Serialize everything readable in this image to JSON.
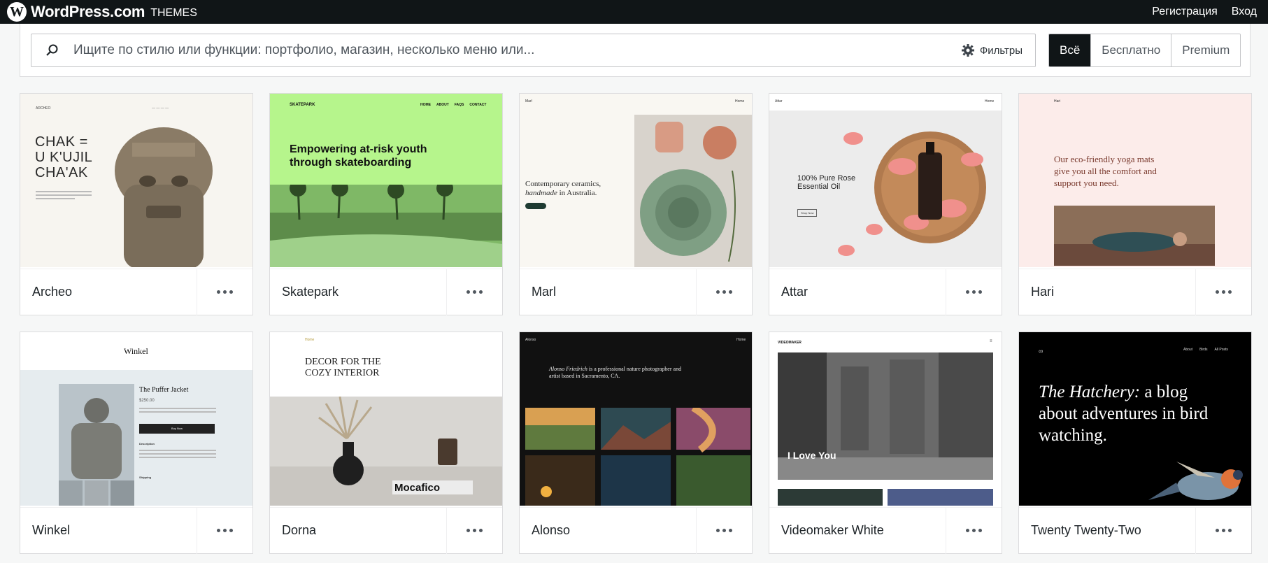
{
  "header": {
    "brand": "WordPress.com",
    "section": "THEMES",
    "signup": "Регистрация",
    "login": "Вход"
  },
  "search": {
    "placeholder": "Ищите по стилю или функции: портфолио, магазин, несколько меню или...",
    "filters_label": "Фильтры"
  },
  "price_filter": {
    "options": [
      "Всё",
      "Бесплатно",
      "Premium"
    ],
    "selected": "Всё"
  },
  "themes": [
    {
      "name": "Archeo",
      "preview": {
        "title_lines": [
          "CHAK =",
          "U K'UJIL",
          "CHA'AK"
        ],
        "logo": "ARCHEO"
      }
    },
    {
      "name": "Skatepark",
      "preview": {
        "headline": "Empowering at-risk youth through skateboarding",
        "logo": "SKATEPARK",
        "nav": [
          "HOME",
          "ABOUT",
          "FAQS",
          "CONTACT"
        ]
      }
    },
    {
      "name": "Marl",
      "preview": {
        "headline_a": "Contemporary ceramics,",
        "headline_b": "handmade",
        "headline_c": " in Australia.",
        "logo": "Marl",
        "nav": "Home"
      }
    },
    {
      "name": "Attar",
      "preview": {
        "headline": "100% Pure Rose Essential Oil",
        "button": "Shop Now",
        "logo": "Attar",
        "nav": "Home"
      }
    },
    {
      "name": "Hari",
      "preview": {
        "headline": "Our eco-friendly yoga mats give you all the comfort and support you need.",
        "logo": "Hari"
      }
    },
    {
      "name": "Winkel",
      "preview": {
        "logo": "Winkel",
        "product": "The Puffer Jacket",
        "price": "$250.00",
        "button": "Buy Now",
        "desc_heading": "Description",
        "ship_heading": "Shipping"
      }
    },
    {
      "name": "Dorna",
      "preview": {
        "headline_1": "DECOR FOR THE",
        "headline_2": "COZY INTERIOR",
        "nav": "Home",
        "book": "Mocafico"
      }
    },
    {
      "name": "Alonso",
      "preview": {
        "name_italic": "Alonso Friedrich",
        "headline": " is a professional nature photographer and artist based in Sacramento, CA.",
        "logo": "Alonso",
        "nav": "Home"
      }
    },
    {
      "name": "Videomaker White",
      "preview": {
        "logo": "VIDEOMAKER",
        "headline": "I Love You"
      }
    },
    {
      "name": "Twenty Twenty-Two",
      "preview": {
        "headline_italic": "The Hatchery:",
        "headline": " a blog about adventures in bird watching.",
        "nav": [
          "About",
          "Birds",
          "All Posts"
        ]
      }
    }
  ]
}
